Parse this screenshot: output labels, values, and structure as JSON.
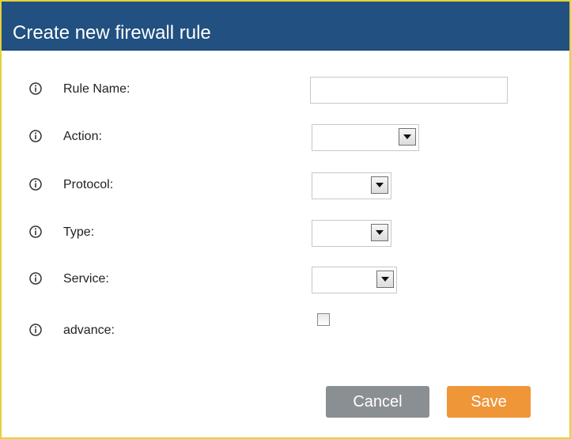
{
  "dialog": {
    "title": "Create new firewall rule"
  },
  "fields": {
    "rule_name": {
      "label": "Rule Name:",
      "value": "",
      "icon": "info-icon"
    },
    "action": {
      "label": "Action:",
      "selected": "",
      "icon": "info-icon"
    },
    "protocol": {
      "label": "Protocol:",
      "selected": "",
      "icon": "info-icon"
    },
    "type": {
      "label": "Type:",
      "selected": "",
      "icon": "info-icon"
    },
    "service": {
      "label": "Service:",
      "selected": "",
      "icon": "info-icon"
    },
    "advance": {
      "label": "advance:",
      "checked": false,
      "icon": "info-icon"
    }
  },
  "buttons": {
    "cancel_label": "Cancel",
    "save_label": "Save"
  },
  "colors": {
    "titlebar": "#215081",
    "cancel": "#8a8f94",
    "save": "#ef9639",
    "frame": "#e3d23a"
  }
}
